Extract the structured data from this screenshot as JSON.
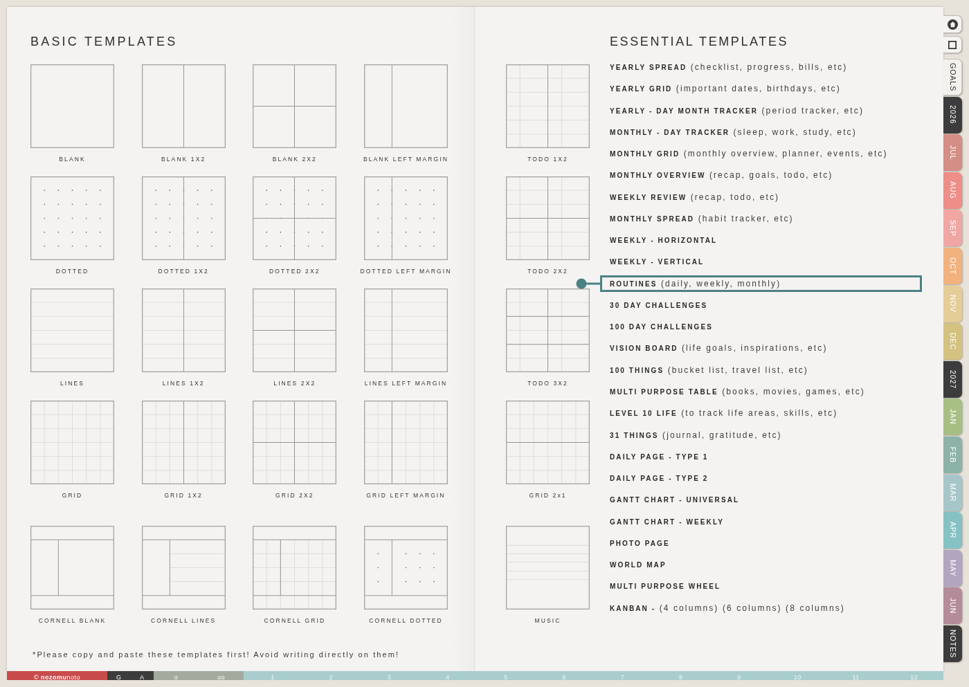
{
  "left_page": {
    "title": "BASIC TEMPLATES",
    "templates": [
      {
        "label": "BLANK",
        "kind": "blank"
      },
      {
        "label": "BLANK 1X2",
        "kind": "blank",
        "vertical_split": true
      },
      {
        "label": "BLANK 2X2",
        "kind": "blank",
        "vertical_split": true,
        "horizontal_split": true
      },
      {
        "label": "BLANK LEFT MARGIN",
        "kind": "blank",
        "left_margin": true
      },
      {
        "label": "DOTTED",
        "kind": "dotted"
      },
      {
        "label": "DOTTED 1X2",
        "kind": "dotted",
        "vertical_split": true
      },
      {
        "label": "DOTTED 2X2",
        "kind": "dotted",
        "vertical_split": true,
        "horizontal_split": true
      },
      {
        "label": "DOTTED LEFT MARGIN",
        "kind": "dotted",
        "left_margin": true
      },
      {
        "label": "LINES",
        "kind": "lines"
      },
      {
        "label": "LINES 1X2",
        "kind": "lines",
        "vertical_split": true
      },
      {
        "label": "LINES 2X2",
        "kind": "lines",
        "vertical_split": true,
        "horizontal_split": true
      },
      {
        "label": "LINES LEFT MARGIN",
        "kind": "lines",
        "left_margin": true
      },
      {
        "label": "GRID",
        "kind": "grid"
      },
      {
        "label": "GRID 1X2",
        "kind": "grid",
        "vertical_split": true
      },
      {
        "label": "GRID 2X2",
        "kind": "grid",
        "vertical_split": true,
        "horizontal_split": true
      },
      {
        "label": "GRID LEFT MARGIN",
        "kind": "grid",
        "left_margin": true
      },
      {
        "label": "CORNELL BLANK",
        "kind": "blank",
        "cornell": true
      },
      {
        "label": "CORNELL LINES",
        "kind": "lines",
        "cornell": true
      },
      {
        "label": "CORNELL GRID",
        "kind": "grid",
        "cornell": true
      },
      {
        "label": "CORNELL DOTTED",
        "kind": "dotted",
        "cornell": true
      }
    ],
    "footnote": "*Please copy and paste these templates first! Avoid writing directly on them!"
  },
  "right_page": {
    "templates": [
      {
        "label": "TODO 1X2",
        "kind": "todo",
        "vertical_split": true
      },
      {
        "label": "TODO 2X2",
        "kind": "todo",
        "vertical_split": true,
        "horizontal_split": true
      },
      {
        "label": "TODO 3X2",
        "kind": "todo",
        "vertical_split": true,
        "third_splits": true
      },
      {
        "label": "GRID 2x1",
        "kind": "grid",
        "horizontal_split": true
      },
      {
        "label": "MUSIC",
        "kind": "staff"
      }
    ],
    "list_title": "ESSENTIAL TEMPLATES",
    "list": [
      {
        "name": "YEARLY SPREAD",
        "note": "(checklist, progress, bills, etc)",
        "selected": false
      },
      {
        "name": "YEARLY GRID",
        "note": "(important dates, birthdays, etc)",
        "selected": false
      },
      {
        "name": "YEARLY - DAY MONTH TRACKER",
        "note": "(period tracker, etc)",
        "selected": false
      },
      {
        "name": "MONTHLY - DAY TRACKER",
        "note": "(sleep, work, study, etc)",
        "selected": false
      },
      {
        "name": "MONTHLY GRID",
        "note": "(monthly overview, planner, events, etc)",
        "selected": false
      },
      {
        "name": "MONTHLY OVERVIEW",
        "note": "(recap, goals, todo, etc)",
        "selected": false
      },
      {
        "name": "WEEKLY REVIEW",
        "note": "(recap, todo, etc)",
        "selected": false
      },
      {
        "name": "MONTHLY SPREAD",
        "note": "(habit tracker, etc)",
        "selected": false
      },
      {
        "name": "WEEKLY - HORIZONTAL",
        "selected": false
      },
      {
        "name": "WEEKLY - VERTICAL",
        "selected": false
      },
      {
        "name": "ROUTINES",
        "note": "(daily, weekly, monthly)",
        "selected": true
      },
      {
        "name": "30 DAY CHALLENGES",
        "selected": false
      },
      {
        "name": "100 DAY CHALLENGES",
        "selected": false
      },
      {
        "name": "VISION BOARD",
        "note": "(life goals, inspirations, etc)",
        "selected": false
      },
      {
        "name": "100 THINGS",
        "note": "(bucket list, travel list, etc)",
        "selected": false
      },
      {
        "name": "MULTI PURPOSE TABLE",
        "note": "(books, movies, games, etc)",
        "selected": false
      },
      {
        "name": "LEVEL 10 LIFE",
        "note": "(to track life areas, skills, etc)",
        "selected": false
      },
      {
        "name": "31 THINGS",
        "note": "(journal, gratitude, etc)",
        "selected": false
      },
      {
        "name": "DAILY PAGE - TYPE 1",
        "selected": false
      },
      {
        "name": "DAILY PAGE - TYPE 2",
        "selected": false
      },
      {
        "name": "GANTT CHART - UNIVERSAL",
        "selected": false
      },
      {
        "name": "GANTT CHART - WEEKLY",
        "selected": false
      },
      {
        "name": "PHOTO PAGE",
        "selected": false
      },
      {
        "name": "WORLD MAP",
        "selected": false
      },
      {
        "name": "MULTI PURPOSE WHEEL",
        "selected": false
      },
      {
        "name": "KANBAN -",
        "note": "(4 columns) (6 columns) (8 columns)",
        "selected": false
      }
    ]
  },
  "side_tabs": [
    {
      "label": "GOALS",
      "color": "#f3f1ed"
    },
    {
      "label": "2026",
      "color": "#3c3c3c"
    },
    {
      "label": "JUL",
      "color": "#d48e86"
    },
    {
      "label": "AUG",
      "color": "#ee8e88"
    },
    {
      "label": "SEP",
      "color": "#f2a6a4"
    },
    {
      "label": "OCT",
      "color": "#f2b27e"
    },
    {
      "label": "NOV",
      "color": "#e5cd98"
    },
    {
      "label": "DEC",
      "color": "#d3c280"
    },
    {
      "label": "2027",
      "color": "#3c3c3c"
    },
    {
      "label": "JAN",
      "color": "#a7bf83"
    },
    {
      "label": "FEB",
      "color": "#8db3a9"
    },
    {
      "label": "MAR",
      "color": "#a6c6ca"
    },
    {
      "label": "APR",
      "color": "#86c2c4"
    },
    {
      "label": "MAY",
      "color": "#b1a5bf"
    },
    {
      "label": "JUN",
      "color": "#b48c99"
    },
    {
      "label": "NOTES",
      "color": "#3c3c3c"
    }
  ],
  "bottom_bar": [
    {
      "kind": "credit",
      "color": "#c94c4c",
      "items": [
        "© **nozomu**noto"
      ]
    },
    {
      "kind": "letters",
      "color": "#3c3c3c",
      "items": [
        "G",
        "A"
      ]
    },
    {
      "kind": "markers",
      "color": "#a3ab9f",
      "items": [
        "o",
        "oo"
      ]
    },
    {
      "kind": "months",
      "color": "#a9cdcc",
      "items": [
        "1",
        "2",
        "3",
        "4",
        "5",
        "6",
        "7",
        "8",
        "9",
        "10",
        "11",
        "12"
      ]
    }
  ]
}
